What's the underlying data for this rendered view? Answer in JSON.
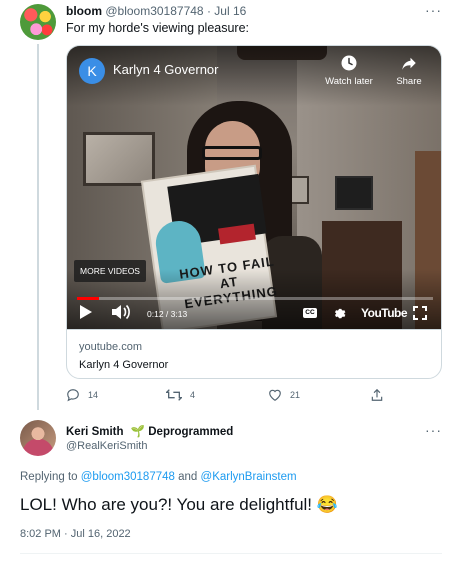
{
  "tweet1": {
    "display_name": "bloom",
    "handle": "@bloom30187748",
    "separator": "·",
    "date": "Jul 16",
    "text": "For my horde's viewing pleasure:",
    "more_icon": "more-dots-icon",
    "embed": {
      "channel_initial": "K",
      "video_title": "Karlyn 4 Governor",
      "watch_later_label": "Watch later",
      "share_label": "Share",
      "more_videos_label": "MORE VIDEOS",
      "book_title": "HOW TO FAIL AT EVERYTHING",
      "time_display": "0:12 / 3:13",
      "progress_fraction": 0.062,
      "cc_label": "CC",
      "youtube_logo": "YouTube",
      "domain": "youtube.com",
      "card_title": "Karlyn 4 Governor"
    },
    "actions": {
      "reply_count": "14",
      "retweet_count": "4",
      "like_count": "21"
    }
  },
  "tweet2": {
    "display_name": "Keri Smith",
    "badge_glyph": "🌱",
    "badge_text": "Deprogrammed",
    "handle": "@RealKeriSmith",
    "replying_prefix": "Replying to",
    "mention1": "@bloom30187748",
    "and_word": "and",
    "mention2": "@KarlynBrainstem",
    "text": "LOL! Who are you?! You are delightful! 😂",
    "timestamp": "8:02 PM · Jul 16, 2022"
  },
  "colors": {
    "accent": "#1d9bf0",
    "secondary_text": "#536471",
    "border": "#cfd9de",
    "progress_red": "#ff0000"
  }
}
